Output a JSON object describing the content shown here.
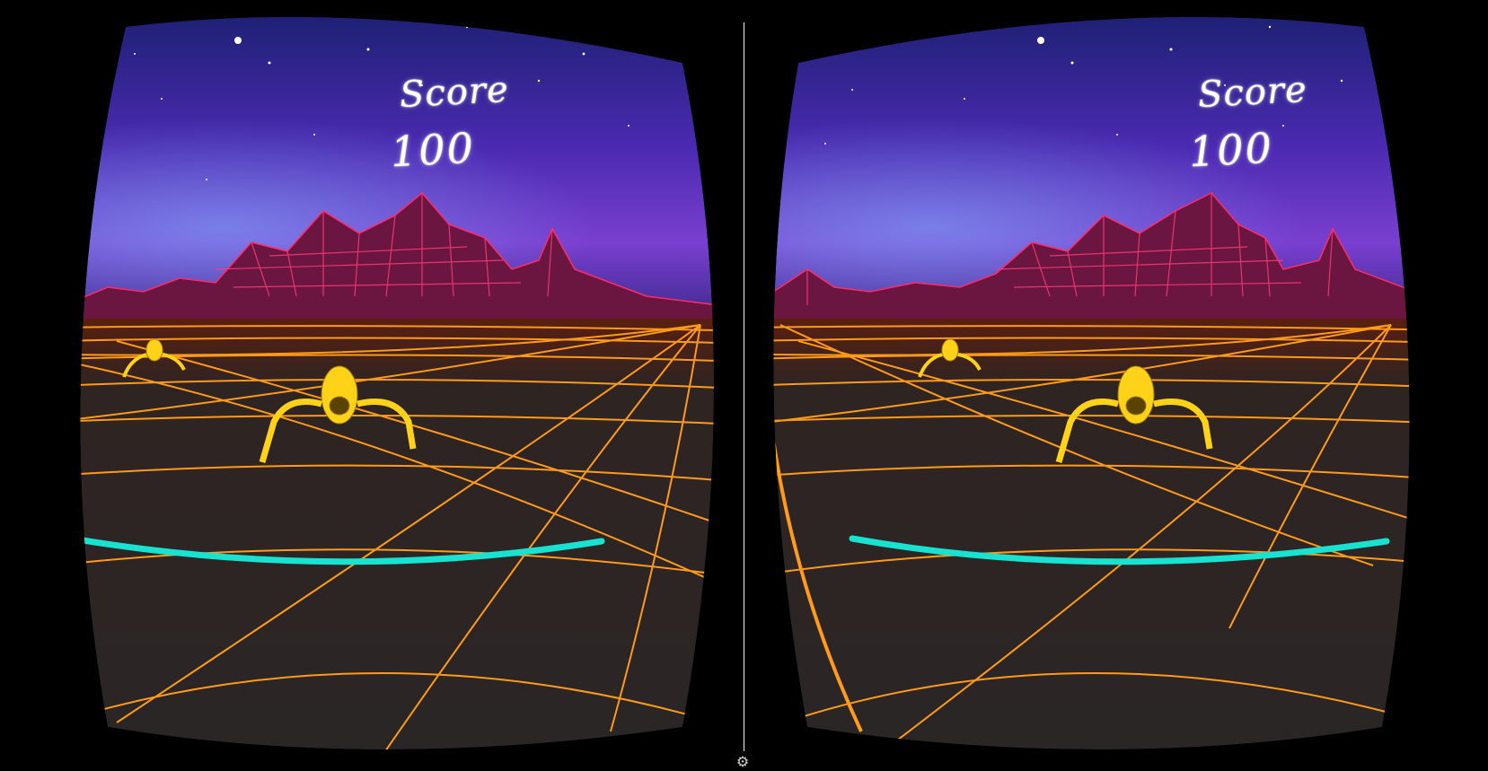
{
  "hud": {
    "score_label": "Score",
    "score_value": "100"
  },
  "icons": {
    "settings": "gear-icon"
  },
  "colors": {
    "grid": "#ff9a1a",
    "ground": "#2a2626",
    "mountains": "#ff2a6a",
    "sky_top": "#1a1f6e",
    "sky_mid": "#5a2fc0",
    "arc": "#17e3d0",
    "spider": "#ffd21a"
  }
}
